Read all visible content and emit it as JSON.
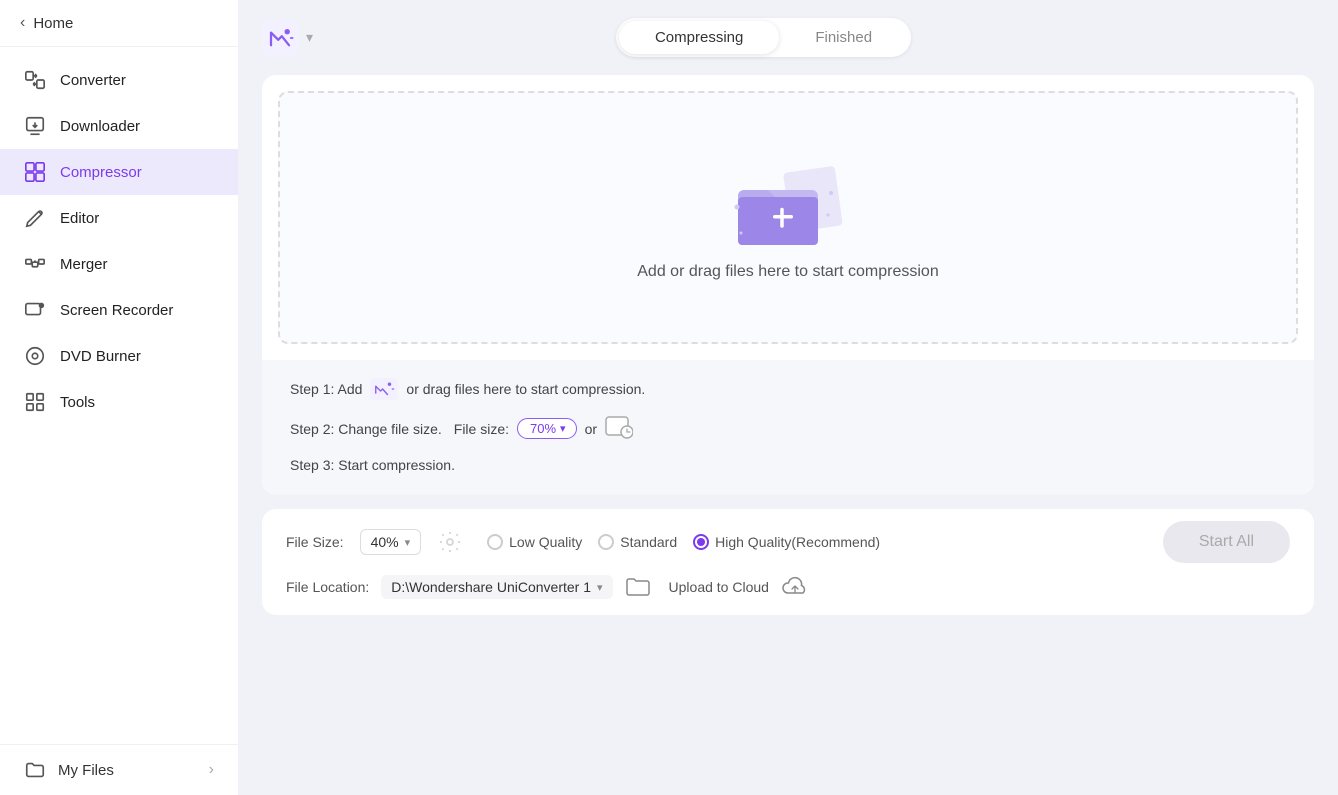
{
  "sidebar": {
    "back_label": "Home",
    "items": [
      {
        "id": "converter",
        "label": "Converter",
        "icon": "📷"
      },
      {
        "id": "downloader",
        "label": "Downloader",
        "icon": "📥"
      },
      {
        "id": "compressor",
        "label": "Compressor",
        "icon": "🗜️",
        "active": true
      },
      {
        "id": "editor",
        "label": "Editor",
        "icon": "✂️"
      },
      {
        "id": "merger",
        "label": "Merger",
        "icon": "🔀"
      },
      {
        "id": "screen-recorder",
        "label": "Screen Recorder",
        "icon": "📷"
      },
      {
        "id": "dvd-burner",
        "label": "DVD Burner",
        "icon": "💿"
      },
      {
        "id": "tools",
        "label": "Tools",
        "icon": "🔧"
      }
    ],
    "footer": {
      "label": "My Files",
      "icon": "📁"
    }
  },
  "topbar": {
    "tabs": [
      {
        "id": "compressing",
        "label": "Compressing",
        "active": true
      },
      {
        "id": "finished",
        "label": "Finished",
        "active": false
      }
    ]
  },
  "dropzone": {
    "text": "Add or drag files here to start compression"
  },
  "steps": [
    {
      "id": "step1",
      "text_before": "Step 1: Add",
      "text_after": "or drag files here to start compression."
    },
    {
      "id": "step2",
      "text_before": "Step 2: Change file size.",
      "file_size_label": "File size:",
      "file_size_value": "70%",
      "or_text": "or"
    },
    {
      "id": "step3",
      "text": "Step 3: Start compression."
    }
  ],
  "bottom": {
    "file_size_label": "File Size:",
    "file_size_value": "40%",
    "quality_options": [
      {
        "id": "low",
        "label": "Low Quality",
        "selected": false
      },
      {
        "id": "standard",
        "label": "Standard",
        "selected": false
      },
      {
        "id": "high",
        "label": "High Quality(Recommend)",
        "selected": true
      }
    ],
    "file_location_label": "File Location:",
    "file_location_path": "D:\\Wondershare UniConverter 1",
    "upload_to_cloud_label": "Upload to Cloud",
    "start_all_label": "Start All"
  }
}
